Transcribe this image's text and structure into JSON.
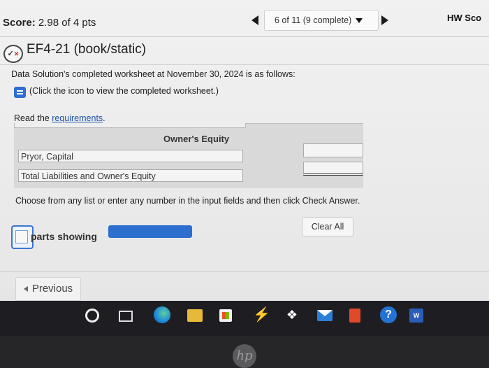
{
  "header": {
    "score_label": "Score:",
    "score_value": "2.98 of 4 pts",
    "question_nav": "6 of 11 (9 complete)",
    "hw_score": "HW Sco"
  },
  "question": {
    "id_title": "EF4-21 (book/static)"
  },
  "content": {
    "intro": "Data Solution's completed worksheet at November 30, 2024 is as follows:",
    "worksheet_link": "(Click the icon to view the completed worksheet.)",
    "read_prefix": "Read the ",
    "requirements_link": "requirements",
    "read_suffix": "."
  },
  "table": {
    "section_header": "Owner's Equity",
    "rows": [
      {
        "label": "Pryor, Capital",
        "amount": ""
      },
      {
        "label": "Total Liabilities and Owner's Equity",
        "amount": ""
      }
    ]
  },
  "footer": {
    "instruction": "Choose from any list or enter any number in the input fields and then click Check Answer.",
    "parts_label": "parts showing",
    "clear_all": "Clear All",
    "previous": "Previous"
  },
  "taskbar": {
    "icons": [
      "search-icon",
      "task-view-icon",
      "edge-icon",
      "file-explorer-icon",
      "store-icon",
      "bolt-icon",
      "dropbox-icon",
      "mail-icon",
      "office-icon",
      "help-icon",
      "word-icon"
    ],
    "word_letter": "W",
    "help_glyph": "?"
  },
  "device": {
    "logo_text": "hp"
  }
}
